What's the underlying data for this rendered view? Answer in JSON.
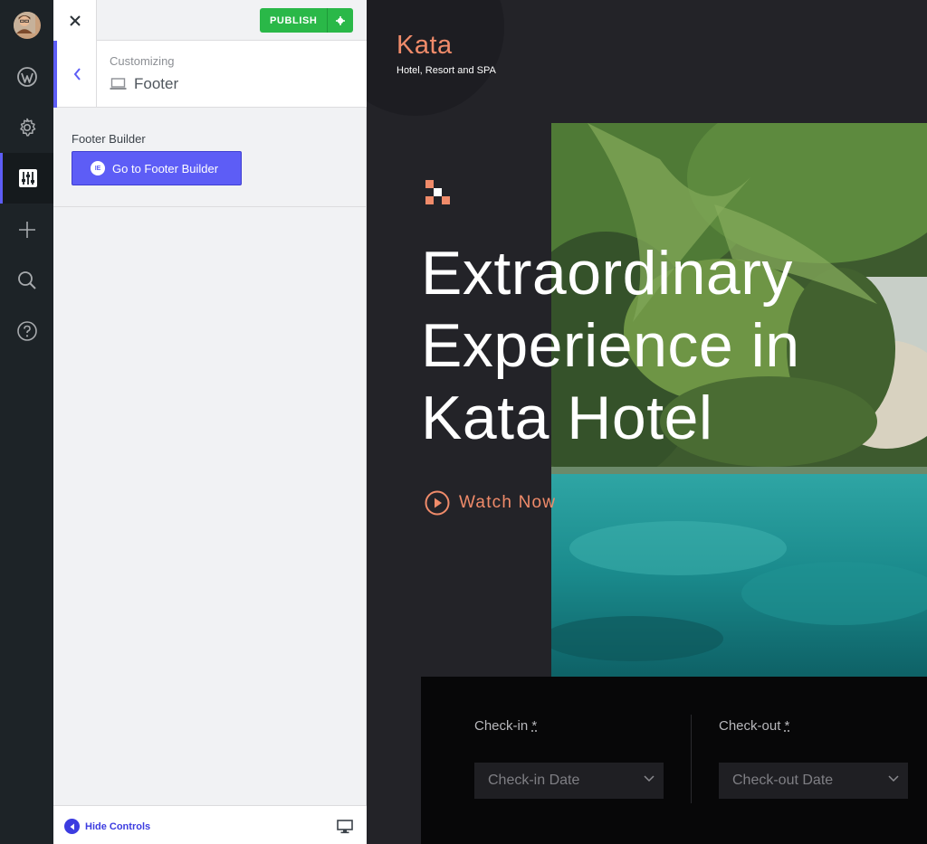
{
  "admin_rail": {
    "items": [
      {
        "name": "avatar"
      },
      {
        "name": "wordpress-icon"
      },
      {
        "name": "gear-icon"
      },
      {
        "name": "customizer-icon",
        "active": true
      },
      {
        "name": "plus-icon"
      },
      {
        "name": "search-icon"
      },
      {
        "name": "help-icon"
      }
    ]
  },
  "customizer": {
    "close_icon": "close-icon",
    "publish_label": "PUBLISH",
    "publish_settings_icon": "gear-icon",
    "breadcrumb": "Customizing",
    "section_title": "Footer",
    "section_icon": "laptop-icon",
    "control_label": "Footer Builder",
    "builder_button_label": "Go to Footer Builder",
    "builder_button_badge": "IE",
    "hide_controls_label": "Hide Controls",
    "device_icon": "desktop-icon"
  },
  "preview": {
    "logo_title": "Kata",
    "logo_subtitle": "Hotel, Resort and SPA",
    "hero_title": "Extraordinary Experience in Kata Hotel",
    "watch_label": "Watch Now",
    "booking": {
      "checkin_label": "Check-in",
      "checkout_label": "Check-out",
      "required_mark": "*",
      "checkin_placeholder": "Check-in Date",
      "checkout_placeholder": "Check-out Date"
    }
  },
  "colors": {
    "accent": "#5d5df6",
    "publish": "#2ab848",
    "brand_orange": "#f08b6a",
    "rail_bg": "#1d2327"
  }
}
